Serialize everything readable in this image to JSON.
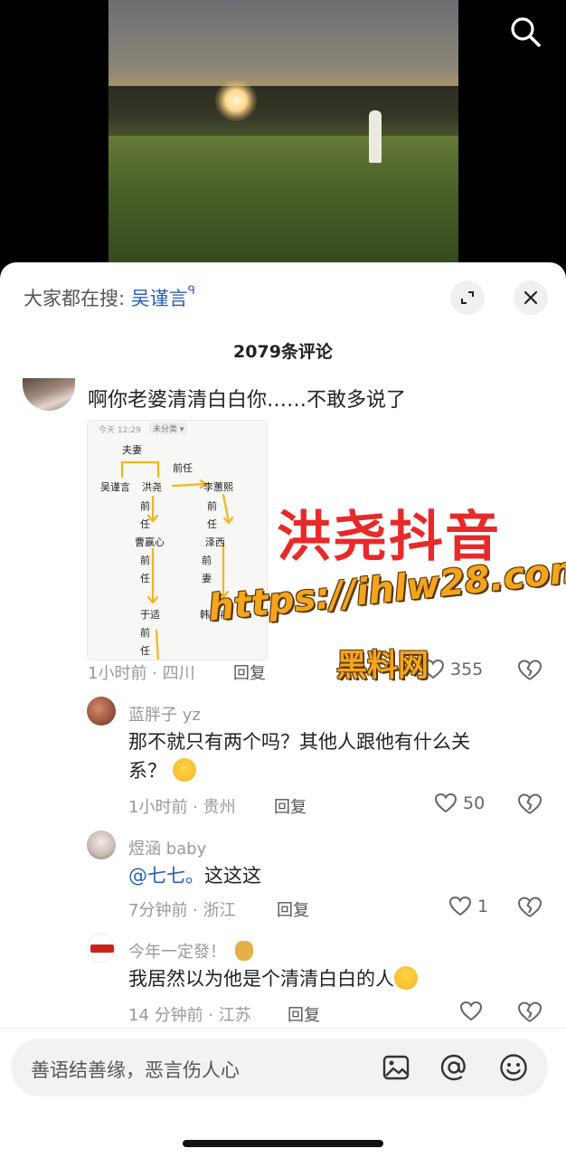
{
  "hot_search": {
    "prefix": "大家都在搜:",
    "keyword": "吴谨言",
    "mag": "ᑫ"
  },
  "comment_count": "2079条评论",
  "main_comment": {
    "text": "啊你老婆清清白白你……不敢多说了",
    "image": {
      "header_time": "今天 12:29",
      "header_tag": "未分类 ▾",
      "labels": {
        "fuqi": "夫妻",
        "qianren_top": "前任",
        "wujinyan": "吴谨言",
        "hongyao": "洪尧",
        "lihuixi": "李蕙熙",
        "qian1": "前",
        "ren1": "任",
        "qian2": "前",
        "ren2": "任",
        "caoyingxin": "曹赢心",
        "zexi": "泽西",
        "qian3": "前",
        "ren3": "任",
        "qian4": "前",
        "qi4": "妻",
        "yushi": "于适",
        "hananran": "韩安冉",
        "qian5": "前",
        "ren5": "任"
      }
    },
    "meta": "1小时前 · 四川",
    "reply": "回复",
    "likes": "355"
  },
  "watermark": {
    "title": "洪尧抖音",
    "url": "https://ihlw28.com",
    "site": "黑料网"
  },
  "replies": [
    {
      "user": "蓝胖子 yz",
      "text_line1": "那不就只有两个吗？其他人跟他有什么关",
      "text_line2": "系？",
      "meta": "1小时前 · 贵州",
      "reply": "回复",
      "likes": "50"
    },
    {
      "user": "煜涵 baby",
      "mention": "@七七。",
      "text": "这这这",
      "meta": "7分钟前 · 浙江",
      "reply": "回复",
      "likes": "1"
    },
    {
      "user": "今年一定發！",
      "text": "我居然以为他是个清清白白的人",
      "meta": "14 分钟前 · 江苏",
      "reply": "回复"
    }
  ],
  "input": {
    "placeholder": "善语结善缘，恶言伤人心"
  },
  "icons": [
    "search-icon",
    "expand-icon",
    "close-icon",
    "heart-icon",
    "broken-heart-icon",
    "image-icon",
    "at-icon",
    "emoji-icon"
  ]
}
